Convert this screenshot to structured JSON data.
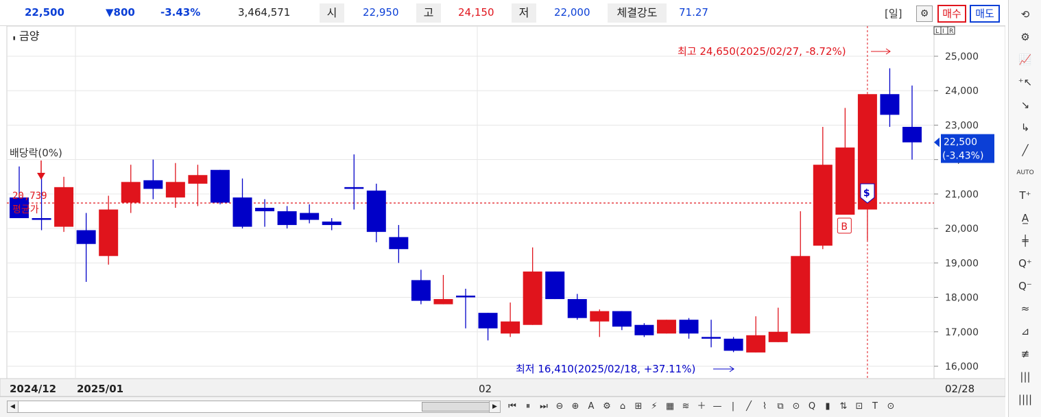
{
  "header": {
    "price": "22,500",
    "change": "▼800",
    "change_pct": "-3.43%",
    "volume": "3,464,571",
    "open_label": "시",
    "open_value": "22,950",
    "high_label": "고",
    "high_value": "24,150",
    "low_label": "저",
    "low_value": "22,000",
    "strength_label": "체결강도",
    "strength_value": "71.27",
    "period_label": "[일]",
    "settings_icon": "gear-icon",
    "buy_label": "매수",
    "sell_label": "매도"
  },
  "chart": {
    "title": "금양",
    "lir_label": "L I R",
    "dividend_label": "배당락(0%)",
    "avg_price_value": "20,739",
    "avg_price_label": "평균가",
    "max_annotation": "최고 24,650(2025/02/27, -8.72%)",
    "min_annotation": "최저 16,410(2025/02/18, +37.11%)",
    "current_price_tag": "22,500",
    "current_change_tag": "(-3.43%)",
    "signal_buy": "B",
    "signal_sell": "$",
    "x_labels": [
      "2024/12",
      "2025/01",
      "02",
      "02/28"
    ],
    "colors": {
      "up": "#e0141c",
      "down": "#0000c8",
      "grid": "#e6e6e6",
      "avg_line": "#e0141c",
      "price_tag_bg": "#0b3fd6"
    }
  },
  "chart_data": {
    "type": "candlestick",
    "title": "금양",
    "ylim": [
      15600,
      25600
    ],
    "y_ticks": [
      "16,000",
      "17,000",
      "18,000",
      "19,000",
      "20,000",
      "21,000",
      "22,000",
      "23,000",
      "24,000",
      "25,000"
    ],
    "y_tick_values": [
      16000,
      17000,
      18000,
      19000,
      20000,
      21000,
      22000,
      23000,
      24000,
      25000
    ],
    "x_labels": [
      "2024/12",
      "2025/01",
      "02",
      "02/28"
    ],
    "average_price": 20739,
    "current_price": 22500,
    "high_point": {
      "value": 24650,
      "date": "2025/02/27"
    },
    "low_point": {
      "value": 16410,
      "date": "2025/02/18"
    },
    "candles": [
      {
        "o": 20900,
        "h": 21800,
        "l": 20600,
        "c": 20300
      },
      {
        "o": 20300,
        "h": 21500,
        "l": 19950,
        "c": 20250
      },
      {
        "o": 20050,
        "h": 21500,
        "l": 19900,
        "c": 21200
      },
      {
        "o": 19950,
        "h": 20450,
        "l": 18450,
        "c": 19550
      },
      {
        "o": 19200,
        "h": 20950,
        "l": 18950,
        "c": 20550
      },
      {
        "o": 20750,
        "h": 21850,
        "l": 20450,
        "c": 21350
      },
      {
        "o": 21400,
        "h": 22000,
        "l": 20850,
        "c": 21150
      },
      {
        "o": 20900,
        "h": 21900,
        "l": 20600,
        "c": 21350
      },
      {
        "o": 21300,
        "h": 21850,
        "l": 20650,
        "c": 21550
      },
      {
        "o": 21700,
        "h": 21700,
        "l": 20700,
        "c": 20750
      },
      {
        "o": 20900,
        "h": 21450,
        "l": 20000,
        "c": 20050
      },
      {
        "o": 20600,
        "h": 20850,
        "l": 20050,
        "c": 20500
      },
      {
        "o": 20500,
        "h": 20650,
        "l": 20000,
        "c": 20100
      },
      {
        "o": 20450,
        "h": 20700,
        "l": 20150,
        "c": 20250
      },
      {
        "o": 20200,
        "h": 20300,
        "l": 19950,
        "c": 20100
      },
      {
        "o": 21200,
        "h": 22150,
        "l": 20550,
        "c": 21150
      },
      {
        "o": 21100,
        "h": 21300,
        "l": 19600,
        "c": 19900
      },
      {
        "o": 19750,
        "h": 20100,
        "l": 19000,
        "c": 19400
      },
      {
        "o": 18500,
        "h": 18800,
        "l": 17800,
        "c": 17900
      },
      {
        "o": 17800,
        "h": 18650,
        "l": 17800,
        "c": 17950
      },
      {
        "o": 18050,
        "h": 18250,
        "l": 17100,
        "c": 18000
      },
      {
        "o": 17550,
        "h": 17550,
        "l": 16750,
        "c": 17100
      },
      {
        "o": 16950,
        "h": 17850,
        "l": 16850,
        "c": 17300
      },
      {
        "o": 17200,
        "h": 19450,
        "l": 17200,
        "c": 18750
      },
      {
        "o": 18750,
        "h": 18750,
        "l": 17950,
        "c": 17950
      },
      {
        "o": 17950,
        "h": 18100,
        "l": 17350,
        "c": 17400
      },
      {
        "o": 17300,
        "h": 17650,
        "l": 16850,
        "c": 17600
      },
      {
        "o": 17600,
        "h": 17600,
        "l": 17050,
        "c": 17150
      },
      {
        "o": 17200,
        "h": 17250,
        "l": 16850,
        "c": 16900
      },
      {
        "o": 16950,
        "h": 17350,
        "l": 16950,
        "c": 17350
      },
      {
        "o": 17350,
        "h": 17400,
        "l": 16800,
        "c": 16950
      },
      {
        "o": 16850,
        "h": 17350,
        "l": 16550,
        "c": 16800
      },
      {
        "o": 16800,
        "h": 16850,
        "l": 16410,
        "c": 16450
      },
      {
        "o": 16400,
        "h": 17450,
        "l": 16400,
        "c": 16900
      },
      {
        "o": 16700,
        "h": 17700,
        "l": 16700,
        "c": 17000
      },
      {
        "o": 16950,
        "h": 20500,
        "l": 16950,
        "c": 19200
      },
      {
        "o": 19500,
        "h": 22950,
        "l": 19400,
        "c": 21850
      },
      {
        "o": 20400,
        "h": 23500,
        "l": 20400,
        "c": 22350
      },
      {
        "o": 20550,
        "h": 23900,
        "l": 19650,
        "c": 23900
      },
      {
        "o": 23900,
        "h": 24650,
        "l": 22950,
        "c": 23300
      },
      {
        "o": 22950,
        "h": 24150,
        "l": 22000,
        "c": 22500
      }
    ]
  },
  "toolbar": {
    "tools": [
      "rotate-icon",
      "gear-icon",
      "indicator-icon",
      "cursor-plus-icon",
      "pen-icon",
      "arrow-icon",
      "line-icon",
      "auto-line-icon",
      "text-plus-icon",
      "text-style-icon",
      "candle-icon",
      "zoom-in-icon",
      "zoom-out-icon",
      "wave-icon",
      "cut-icon",
      "fib-icon",
      "bars-icon",
      "bars2-icon"
    ],
    "labels": [
      "⟲",
      "⚙",
      "📈",
      "⁺↖",
      "↘",
      "↳",
      "╱",
      "AUTO",
      "T⁺",
      "A̲",
      "╪",
      "Q⁺",
      "Q⁻",
      "≈",
      "⊿",
      "≢",
      "|||",
      "||||"
    ]
  },
  "bottombar": {
    "nav_labels": [
      "⏮",
      "⏸",
      "⏭",
      "⊖",
      "⊕",
      "A",
      "⚙",
      "⌂",
      "⊞",
      "⚡",
      "▦",
      "≋",
      "＋",
      "—",
      "|",
      "╱",
      "⌇",
      "⧉",
      "⊙",
      "Q",
      "▮",
      "⇅",
      "⊡",
      "T",
      "⊙"
    ]
  }
}
